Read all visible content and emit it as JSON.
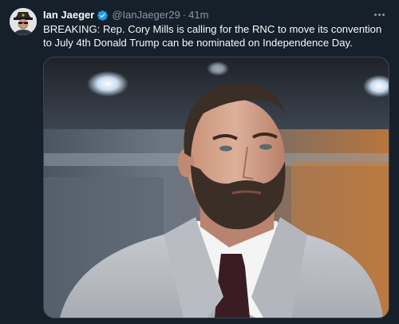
{
  "tweet": {
    "author_name": "Ian Jaeger",
    "verified": true,
    "handle": "@IanJaeger29",
    "separator": "·",
    "time": "41m",
    "text": "BREAKING: Rep. Cory Mills is calling for the RNC to move its convention to July 4th Donald Trump can be nominated on Independence Day.",
    "more_icon": "more-horizontal-icon",
    "verified_icon": "verified-badge-icon"
  },
  "colors": {
    "background": "#15202b",
    "text": "#f7f9f9",
    "secondary_text": "#8b98a5",
    "verified": "#1d9bf0",
    "border": "#38444d"
  }
}
